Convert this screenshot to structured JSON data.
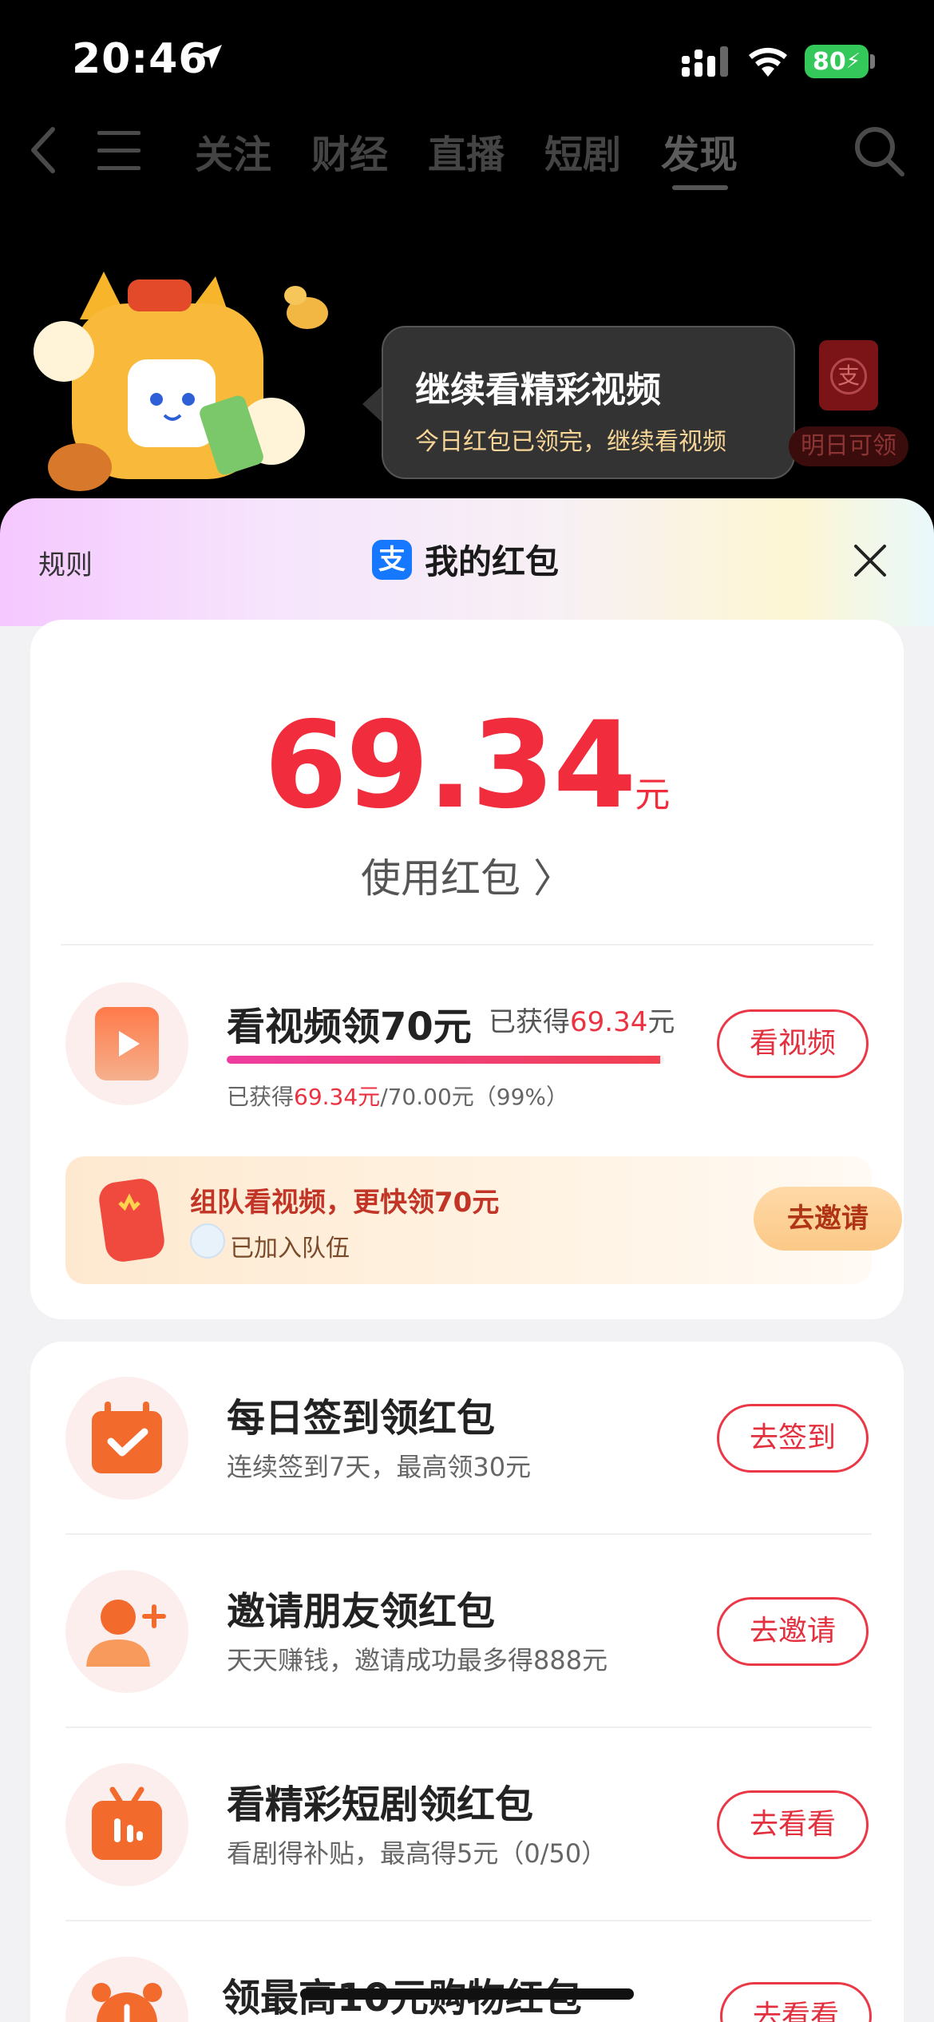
{
  "status": {
    "time": "20:46",
    "battery": "80"
  },
  "nav": {
    "tabs": [
      "关注",
      "财经",
      "直播",
      "短剧",
      "发现"
    ],
    "active": "发现"
  },
  "promo": {
    "bubble_title": "继续看精彩视频",
    "bubble_sub": "今日红包已领完，继续看视频",
    "tomorrow": "明日可领",
    "env_glyph": "支"
  },
  "sheet": {
    "rules": "规则",
    "title": "我的红包",
    "alipay_glyph": "支",
    "amount": "69.34",
    "unit": "元",
    "use_label": "使用红包 〉"
  },
  "video_task": {
    "title": "看视频领70元",
    "earned_prefix": "已获得",
    "earned_value": "69.34",
    "earned_unit": "元",
    "progress_prefix": "已获得",
    "progress_value": "69.34元",
    "progress_suffix": "/70.00元（99%）",
    "progress": 0.99,
    "button": "看视频"
  },
  "team": {
    "title": "组队看视频，更快领70元",
    "sub": "已加入队伍",
    "button": "去邀请"
  },
  "tasks": [
    {
      "title": "每日签到领红包",
      "sub": "连续签到7天，最高领30元",
      "button": "去签到",
      "icon": "calendar-check-icon"
    },
    {
      "title": "邀请朋友领红包",
      "sub": "天天赚钱，邀请成功最多得888元",
      "button": "去邀请",
      "icon": "add-friend-icon"
    },
    {
      "title": "看精彩短剧领红包",
      "sub": "看剧得补贴，最高得5元（0/50）",
      "button": "去看看",
      "icon": "tv-icon"
    },
    {
      "title": "领最高10元购物红包",
      "sub": "",
      "button": "去看看",
      "icon": "alarm-clock-icon"
    }
  ],
  "colors": {
    "accent": "#ec3140",
    "alipay": "#1677ff"
  }
}
